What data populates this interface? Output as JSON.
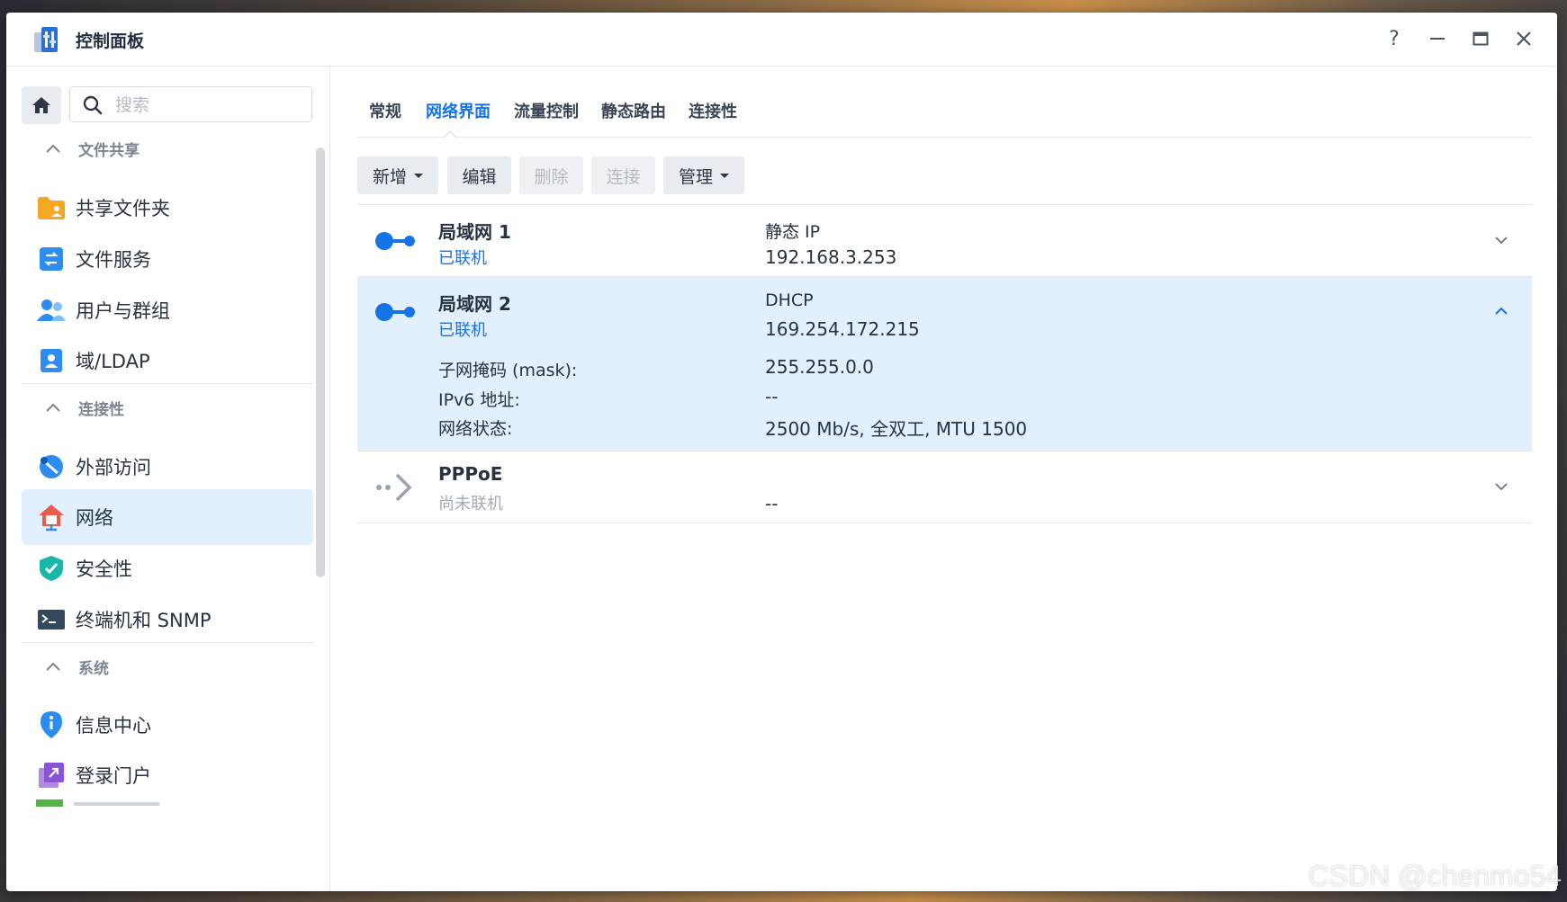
{
  "window": {
    "title": "控制面板",
    "help_glyph": "?",
    "controls": [
      "help-icon",
      "minimize-icon",
      "maximize-icon",
      "close-icon"
    ]
  },
  "sidebar": {
    "search_placeholder": "搜索",
    "groups": [
      {
        "label": "文件共享",
        "items": [
          {
            "label": "共享文件夹",
            "icon": "folder-share-icon"
          },
          {
            "label": "文件服务",
            "icon": "file-services-icon"
          },
          {
            "label": "用户与群组",
            "icon": "users-icon"
          },
          {
            "label": "域/LDAP",
            "icon": "ldap-icon"
          }
        ]
      },
      {
        "label": "连接性",
        "items": [
          {
            "label": "外部访问",
            "icon": "external-access-icon"
          },
          {
            "label": "网络",
            "icon": "network-icon",
            "active": true
          },
          {
            "label": "安全性",
            "icon": "security-shield-icon"
          },
          {
            "label": "终端机和 SNMP",
            "icon": "terminal-icon"
          }
        ]
      },
      {
        "label": "系统",
        "items": [
          {
            "label": "信息中心",
            "icon": "info-center-icon"
          },
          {
            "label": "登录门户",
            "icon": "login-portal-icon"
          }
        ]
      }
    ]
  },
  "main": {
    "tabs": [
      {
        "label": "常规",
        "active": false
      },
      {
        "label": "网络界面",
        "active": true
      },
      {
        "label": "流量控制",
        "active": false
      },
      {
        "label": "静态路由",
        "active": false
      },
      {
        "label": "连接性",
        "active": false
      }
    ],
    "toolbar": {
      "add": "新增",
      "edit": "编辑",
      "delete": "删除",
      "connect": "连接",
      "manage": "管理"
    },
    "interfaces": [
      {
        "name": "局域网 1",
        "status": "已联机",
        "type": "静态 IP",
        "ip": "192.168.3.253",
        "expanded": false
      },
      {
        "name": "局域网 2",
        "status": "已联机",
        "type": "DHCP",
        "ip": "169.254.172.215",
        "expanded": true,
        "details": [
          {
            "label": "子网掩码 (mask):",
            "value": "255.255.0.0"
          },
          {
            "label": "IPv6 地址:",
            "value": "--"
          },
          {
            "label": "网络状态:",
            "value": "2500 Mb/s, 全双工, MTU 1500"
          }
        ]
      },
      {
        "name": "PPPoE",
        "status": "尚未联机",
        "type": "",
        "ip": "--",
        "expanded": false
      }
    ]
  },
  "colors": {
    "accent": "#1474e6",
    "active_bg": "#e2f0fd",
    "text": "#283240",
    "muted": "#a3aab4"
  },
  "watermark": "CSDN @chenmo54"
}
